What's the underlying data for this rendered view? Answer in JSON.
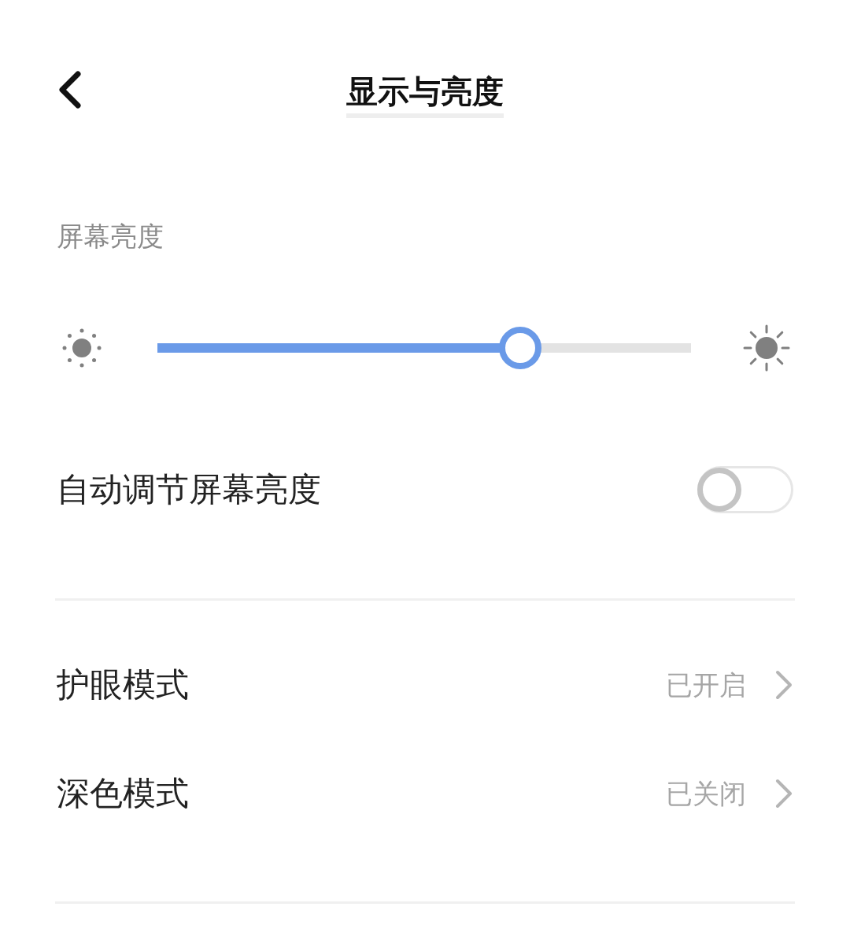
{
  "header": {
    "title": "显示与亮度"
  },
  "brightness": {
    "label": "屏幕亮度",
    "level": 0.68
  },
  "auto_brightness": {
    "label": "自动调节屏幕亮度",
    "on": false
  },
  "rows": [
    {
      "label": "护眼模式",
      "value": "已开启"
    },
    {
      "label": "深色模式",
      "value": "已关闭"
    }
  ]
}
